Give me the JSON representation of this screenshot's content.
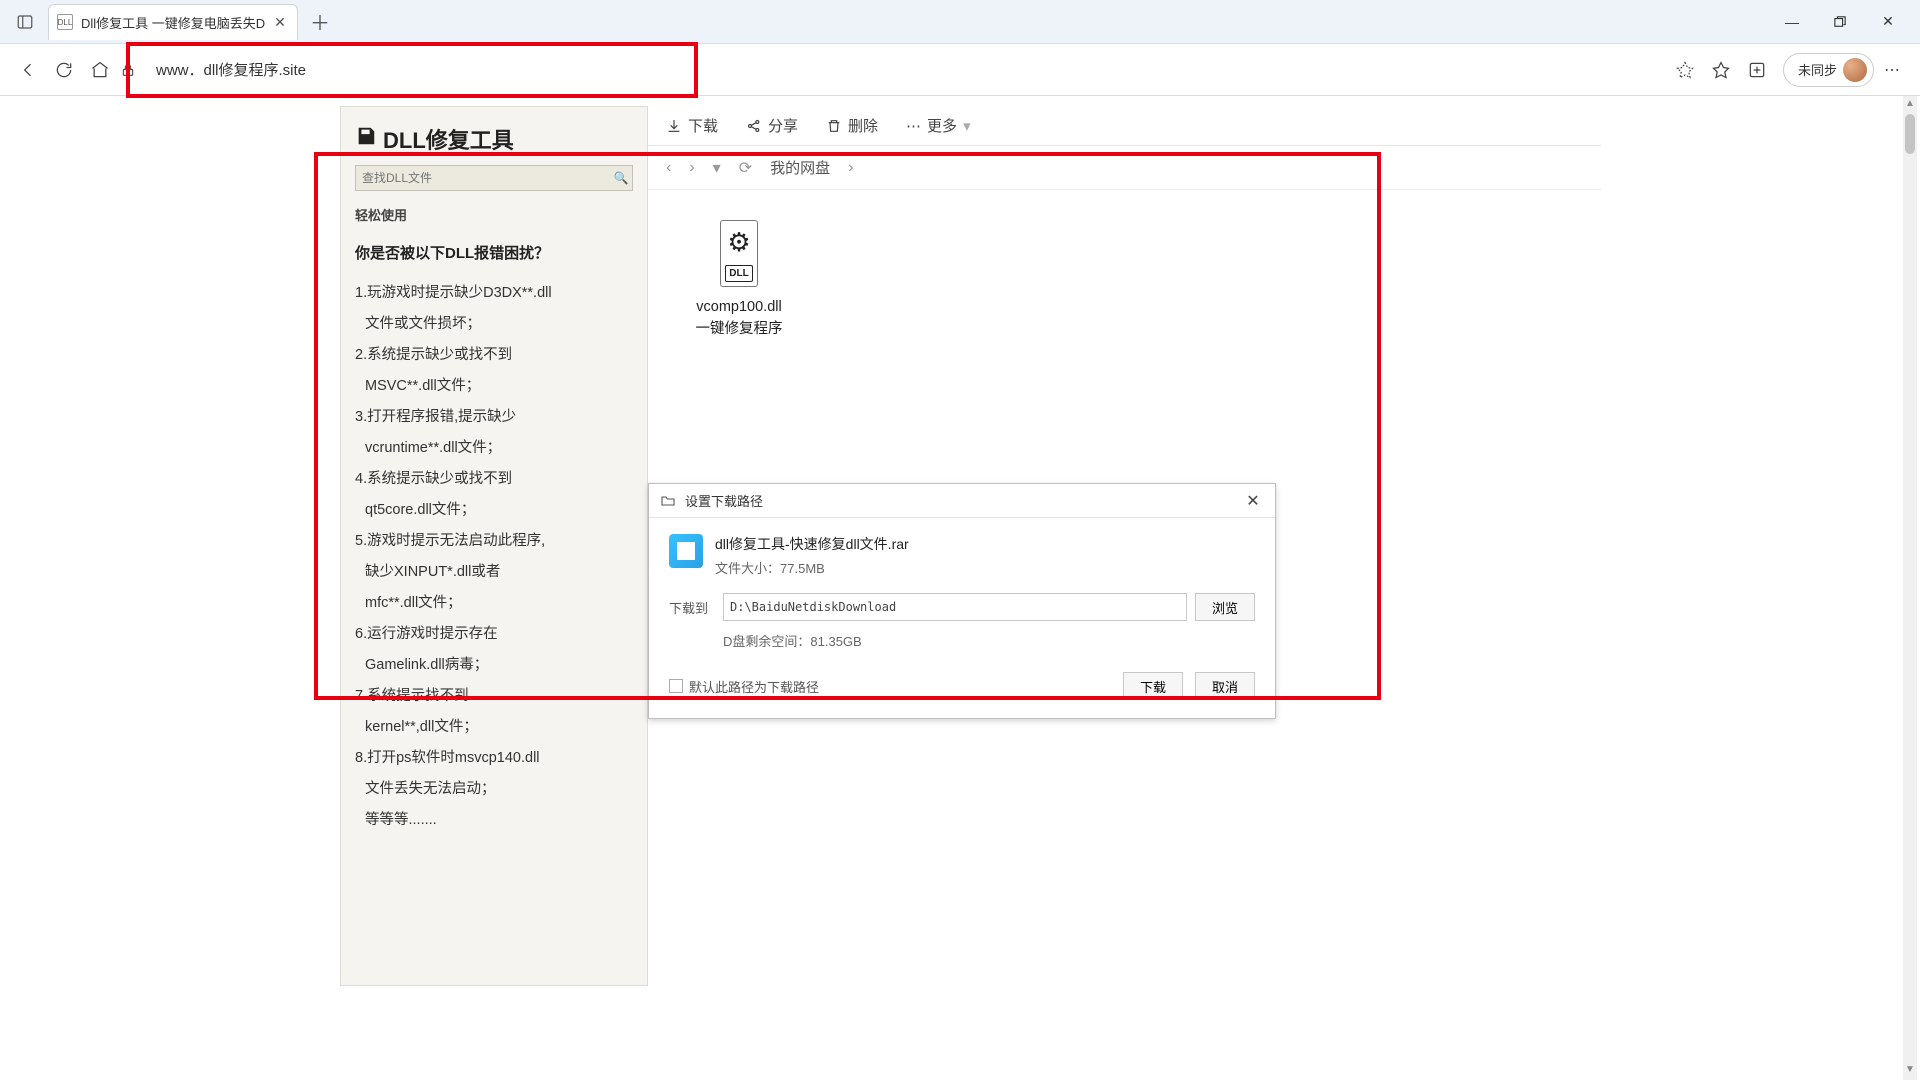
{
  "browser": {
    "tab_title": "Dll修复工具 一键修复电脑丢失D",
    "url": "www．dll修复程序.site",
    "sync_label": "未同步"
  },
  "sidebar": {
    "title": "DLL修复工具",
    "search_placeholder": "查找DLL文件",
    "easy_use_label": "轻松使用",
    "question": "你是否被以下DLL报错困扰？",
    "items": [
      "1.玩游戏时提示缺少D3DX**.dll",
      "文件或文件损坏；",
      "2.系统提示缺少或找不到",
      "MSVC**.dll文件；",
      "3.打开程序报错,提示缺少",
      "vcruntime**.dll文件；",
      "4.系统提示缺少或找不到",
      "qt5core.dll文件；",
      "5.游戏时提示无法启动此程序,",
      "缺少XINPUT*.dll或者",
      "mfc**.dll文件；",
      "6.运行游戏时提示存在",
      "Gamelink.dll病毒；",
      "7.系统提示找不到",
      "kernel**,dll文件；",
      "8.打开ps软件时msvcp140.dll",
      "文件丢失无法启动；",
      "等等等......."
    ]
  },
  "toolbar": {
    "download": "下载",
    "share": "分享",
    "delete": "删除",
    "more": "更多"
  },
  "crumbs": {
    "root": "我的网盘",
    "sep": "›"
  },
  "file": {
    "icon_label": "DLL",
    "name_line1": "vcomp100.dll",
    "name_line2": "一键修复程序"
  },
  "dialog": {
    "title": "设置下载路径",
    "file_name": "dll修复工具-快速修复dll文件.rar",
    "file_size_label": "文件大小：",
    "file_size": "77.5MB",
    "path_label": "下载到",
    "path_value": "D:\\BaiduNetdiskDownload",
    "browse_label": "浏览",
    "space_label": "D盘剩余空间：",
    "space_value": "81.35GB",
    "remember_label": "默认此路径为下载路径",
    "download_btn": "下载",
    "cancel_btn": "取消"
  }
}
